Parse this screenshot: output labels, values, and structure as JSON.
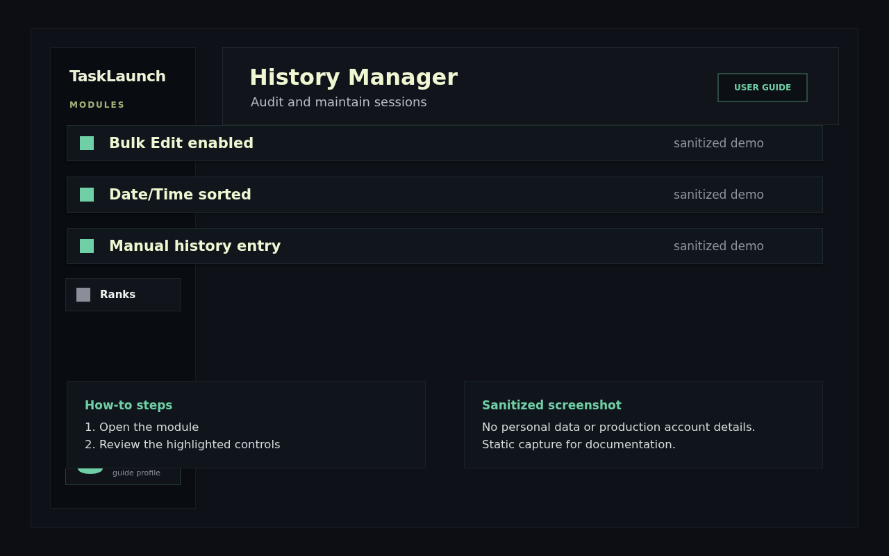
{
  "sidebar": {
    "title": "TaskLaunch",
    "section_label": "MODULES",
    "items": [
      {
        "label": "Ranks",
        "enabled": false
      }
    ],
    "profile": {
      "caption": "guide profile"
    }
  },
  "header": {
    "title": "History Manager",
    "subtitle": "Audit and maintain sessions",
    "button": "USER GUIDE"
  },
  "features": [
    {
      "label": "Bulk Edit enabled",
      "enabled": true,
      "note": "sanitized demo"
    },
    {
      "label": "Date/Time sorted",
      "enabled": true,
      "note": "sanitized demo"
    },
    {
      "label": "Manual history entry",
      "enabled": true,
      "note": "sanitized demo"
    }
  ],
  "info_cards": [
    {
      "title": "How-to steps",
      "lines": [
        "1. Open the module",
        "2. Review the highlighted controls"
      ]
    },
    {
      "title": "Sanitized screenshot",
      "lines": [
        "No personal data or production account details.",
        "Static capture for documentation."
      ]
    }
  ]
}
